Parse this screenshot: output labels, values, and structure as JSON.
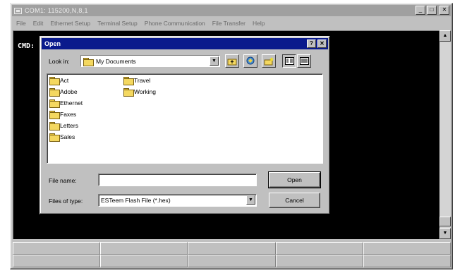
{
  "window": {
    "title": "COM1: 115200,N,8,1",
    "buttons": {
      "minimize": "_",
      "maximize": "□",
      "close": "✕"
    }
  },
  "menubar": [
    "File",
    "Edit",
    "Ethernet Setup",
    "Terminal Setup",
    "Phone Communication",
    "File Transfer",
    "Help"
  ],
  "terminal": {
    "prompt": "CMD:"
  },
  "dialog": {
    "title": "Open",
    "help_button": "?",
    "close_button": "✕",
    "look_in_label": "Look in:",
    "look_in_value": "My Documents",
    "folders": [
      "Act",
      "Adobe",
      "Ethernet",
      "Faxes",
      "Letters",
      "Sales",
      "Travel",
      "Working"
    ],
    "file_name_label": "File name:",
    "file_name_value": "",
    "files_of_type_label": "Files of type:",
    "files_of_type_value": "ESTeem Flash File (*.hex)",
    "open_button": "Open",
    "cancel_button": "Cancel"
  },
  "icons": {
    "folder": "folder-icon",
    "up_folder": "up-one-level-icon",
    "desktop": "desktop-icon",
    "new_folder": "new-folder-icon",
    "list_view": "list-view-icon",
    "details_view": "details-view-icon"
  },
  "colors": {
    "dialog_title": "#0a1a8c",
    "terminal_bg": "#000000",
    "folder": "#f4d860"
  }
}
